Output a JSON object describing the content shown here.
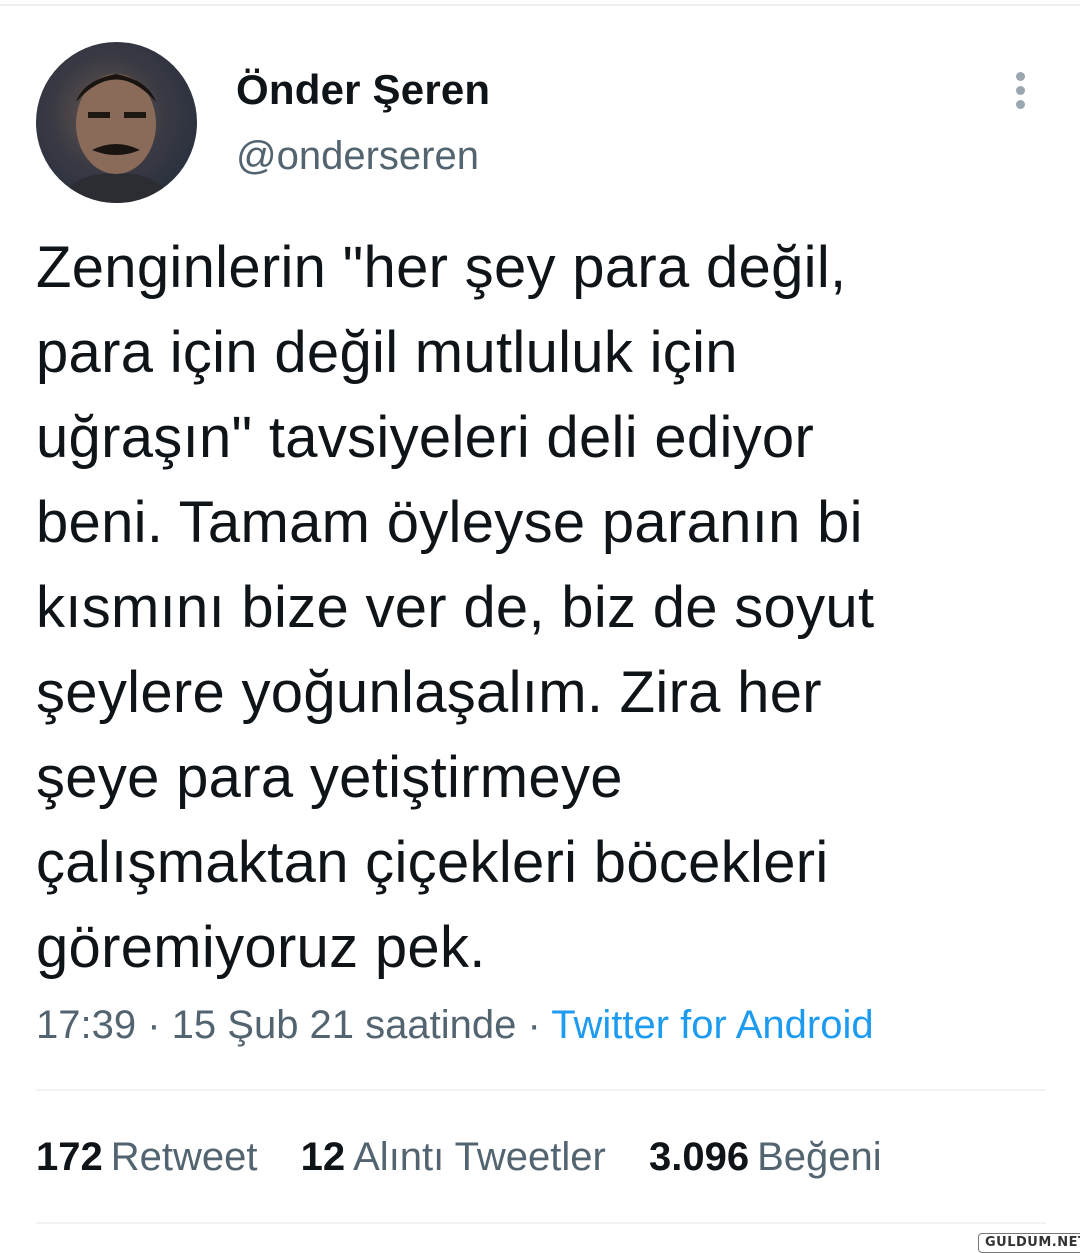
{
  "author": {
    "display_name": "Önder Şeren",
    "handle": "@onderseren"
  },
  "more_icon": "more-vertical-icon",
  "tweet": {
    "text": "Zenginlerin \"her şey para değil,\npara için değil mutluluk için\nuğraşın\" tavsiyeleri deli ediyor\nbeni. Tamam öyleyse paranın bi\nkısmını bize ver de, biz de soyut\nşeylere yoğunlaşalım. Zira her\nşeye para yetiştirmeye\nçalışmaktan çiçekleri böcekleri\ngöremiyoruz pek."
  },
  "meta": {
    "time": "17:39",
    "separator": " · ",
    "date": "15 Şub 21 saatinde",
    "source": "Twitter for Android"
  },
  "stats": [
    {
      "count": "172",
      "label": "Retweet"
    },
    {
      "count": "12",
      "label": "Alıntı Tweetler"
    },
    {
      "count": "3.096",
      "label": "Beğeni"
    }
  ],
  "watermark": "GULDUM.NET",
  "colors": {
    "text": "#0f1419",
    "secondary": "#536471",
    "link": "#1d9bf0",
    "divider": "#eff3f4"
  }
}
